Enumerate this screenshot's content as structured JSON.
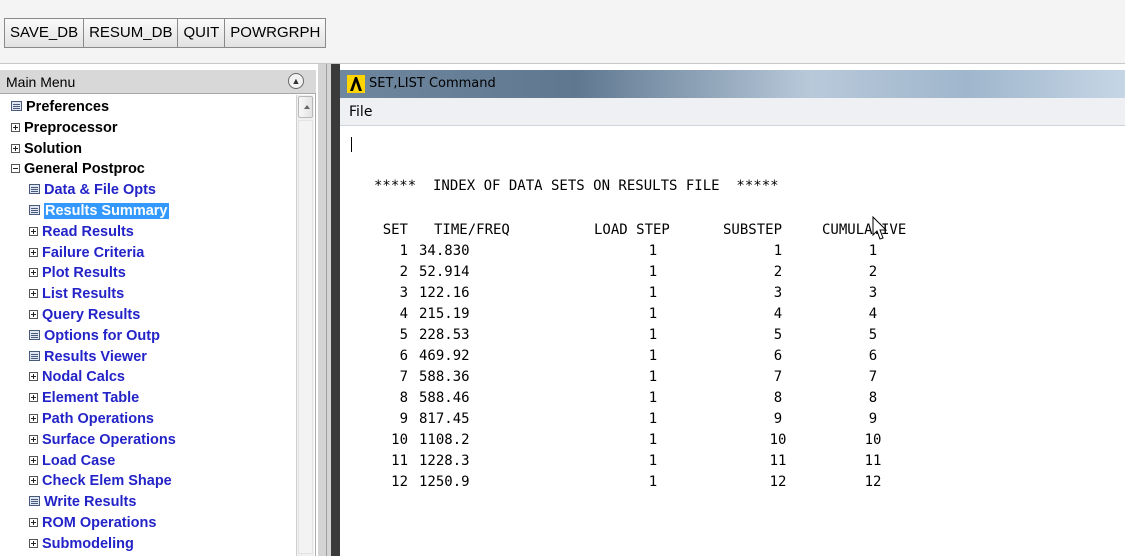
{
  "toolbar": {
    "buttons": [
      "SAVE_DB",
      "RESUM_DB",
      "QUIT",
      "POWRGRPH"
    ]
  },
  "main_menu": {
    "title": "Main Menu",
    "items": [
      {
        "label": "Preferences",
        "level": 0,
        "marker": "doc"
      },
      {
        "label": "Preprocessor",
        "level": 0,
        "marker": "expand"
      },
      {
        "label": "Solution",
        "level": 0,
        "marker": "expand"
      },
      {
        "label": "General Postproc",
        "level": 0,
        "marker": "collapse"
      },
      {
        "label": "Data & File Opts",
        "level": 1,
        "marker": "doc"
      },
      {
        "label": "Results Summary",
        "level": 1,
        "marker": "doc",
        "selected": true
      },
      {
        "label": "Read Results",
        "level": 1,
        "marker": "expand"
      },
      {
        "label": "Failure Criteria",
        "level": 1,
        "marker": "expand"
      },
      {
        "label": "Plot Results",
        "level": 1,
        "marker": "expand"
      },
      {
        "label": "List Results",
        "level": 1,
        "marker": "expand"
      },
      {
        "label": "Query Results",
        "level": 1,
        "marker": "expand"
      },
      {
        "label": "Options for Outp",
        "level": 1,
        "marker": "doc"
      },
      {
        "label": "Results Viewer",
        "level": 1,
        "marker": "doc"
      },
      {
        "label": "Nodal Calcs",
        "level": 1,
        "marker": "expand"
      },
      {
        "label": "Element Table",
        "level": 1,
        "marker": "expand"
      },
      {
        "label": "Path Operations",
        "level": 1,
        "marker": "expand"
      },
      {
        "label": "Surface Operations",
        "level": 1,
        "marker": "expand"
      },
      {
        "label": "Load Case",
        "level": 1,
        "marker": "expand"
      },
      {
        "label": "Check Elem Shape",
        "level": 1,
        "marker": "expand"
      },
      {
        "label": "Write Results",
        "level": 1,
        "marker": "doc"
      },
      {
        "label": "ROM Operations",
        "level": 1,
        "marker": "expand"
      },
      {
        "label": "Submodeling",
        "level": 1,
        "marker": "expand"
      }
    ]
  },
  "command_window": {
    "title": "SET,LIST Command",
    "menu": {
      "file": "File"
    },
    "listing_title": "*****  INDEX OF DATA SETS ON RESULTS FILE  *****",
    "headers": {
      "set": "SET",
      "time_freq": "TIME/FREQ",
      "load_step": "LOAD STEP",
      "substep": "SUBSTEP",
      "cumulative": "CUMULATIVE"
    },
    "rows": [
      {
        "set": "1",
        "time_freq": "34.830",
        "load_step": "1",
        "substep": "1",
        "cumulative": "1"
      },
      {
        "set": "2",
        "time_freq": "52.914",
        "load_step": "1",
        "substep": "2",
        "cumulative": "2"
      },
      {
        "set": "3",
        "time_freq": "122.16",
        "load_step": "1",
        "substep": "3",
        "cumulative": "3"
      },
      {
        "set": "4",
        "time_freq": "215.19",
        "load_step": "1",
        "substep": "4",
        "cumulative": "4"
      },
      {
        "set": "5",
        "time_freq": "228.53",
        "load_step": "1",
        "substep": "5",
        "cumulative": "5"
      },
      {
        "set": "6",
        "time_freq": "469.92",
        "load_step": "1",
        "substep": "6",
        "cumulative": "6"
      },
      {
        "set": "7",
        "time_freq": "588.36",
        "load_step": "1",
        "substep": "7",
        "cumulative": "7"
      },
      {
        "set": "8",
        "time_freq": "588.46",
        "load_step": "1",
        "substep": "8",
        "cumulative": "8"
      },
      {
        "set": "9",
        "time_freq": "817.45",
        "load_step": "1",
        "substep": "9",
        "cumulative": "9"
      },
      {
        "set": "10",
        "time_freq": "1108.2",
        "load_step": "1",
        "substep": "10",
        "cumulative": "10"
      },
      {
        "set": "11",
        "time_freq": "1228.3",
        "load_step": "1",
        "substep": "11",
        "cumulative": "11"
      },
      {
        "set": "12",
        "time_freq": "1250.9",
        "load_step": "1",
        "substep": "12",
        "cumulative": "12"
      }
    ]
  },
  "icons": {
    "collapse_panel": "double-chevron-up-icon",
    "app_icon": "ansys-logo-icon",
    "cursor": "mouse-pointer-icon"
  },
  "colors": {
    "menu_item_blue": "#2323c8",
    "selection": "#3399ff",
    "titlebar": "#6f879e"
  }
}
